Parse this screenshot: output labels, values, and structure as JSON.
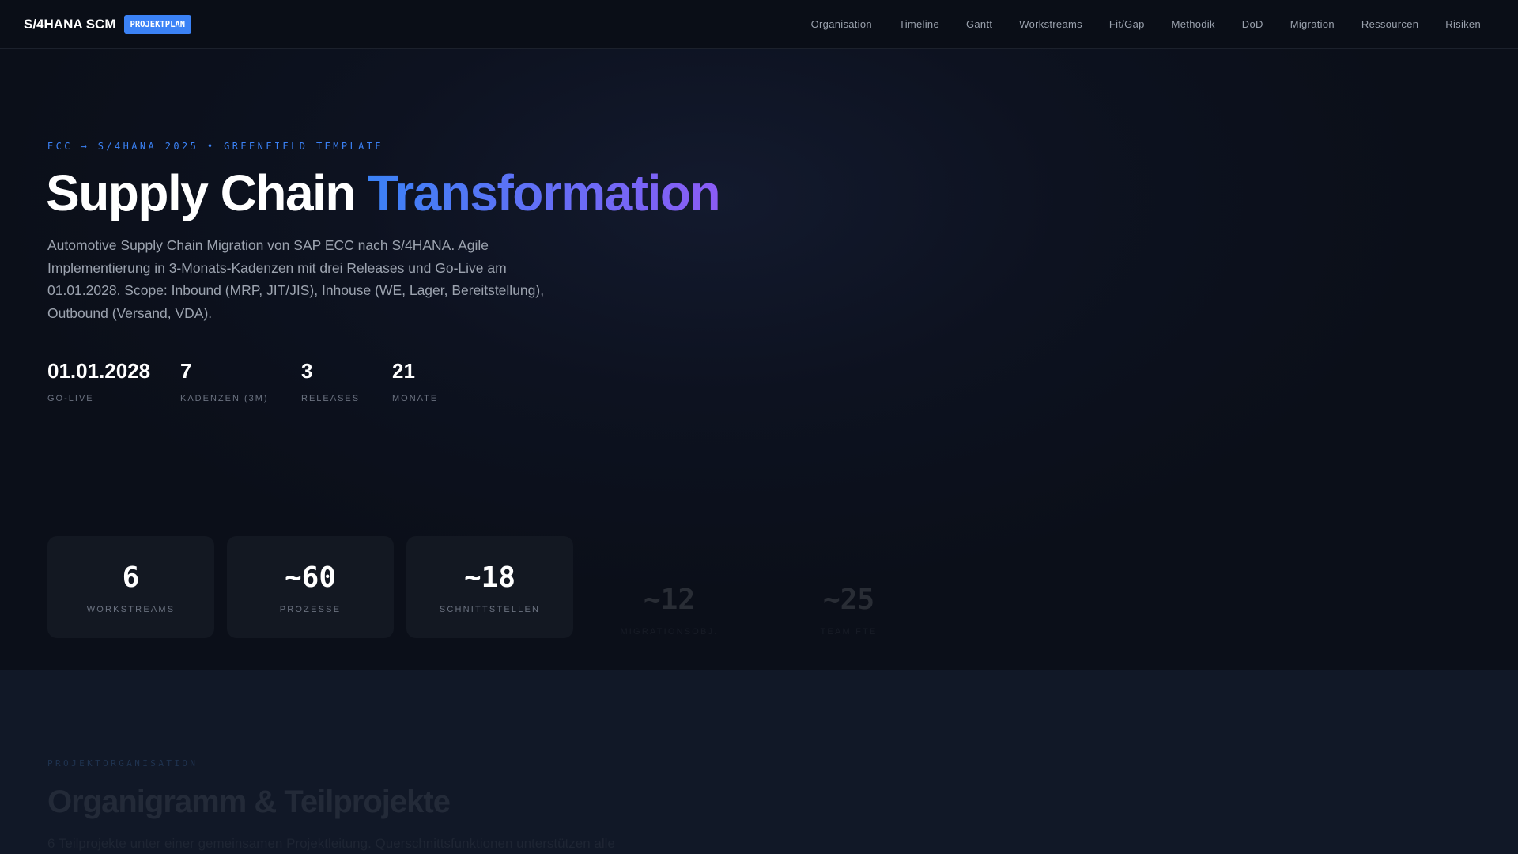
{
  "nav": {
    "logo": "S/4HANA SCM",
    "badge": "PROJEKTPLAN",
    "links": [
      "Organisation",
      "Timeline",
      "Gantt",
      "Workstreams",
      "Fit/Gap",
      "Methodik",
      "DoD",
      "Migration",
      "Ressourcen",
      "Risiken"
    ]
  },
  "hero": {
    "eyebrow": "ECC → S/4HANA 2025 • GREENFIELD TEMPLATE",
    "title_a": "Supply Chain ",
    "title_b": "Transformation",
    "lead": "Automotive Supply Chain Migration von SAP ECC nach S/4HANA. Agile Implementierung in 3-Monats-Kadenzen mit drei Releases und Go-Live am 01.01.2028. Scope: Inbound (MRP, JIT/JIS), Inhouse (WE, Lager, Bereitstellung), Outbound (Versand, VDA).",
    "stats": [
      {
        "value": "01.01.2028",
        "label": "GO-LIVE"
      },
      {
        "value": "7",
        "label": "KADENZEN (3M)"
      },
      {
        "value": "3",
        "label": "RELEASES"
      },
      {
        "value": "21",
        "label": "MONATE"
      }
    ],
    "cards": [
      {
        "value": "6",
        "label": "WORKSTREAMS"
      },
      {
        "value": "~60",
        "label": "PROZESSE"
      },
      {
        "value": "~18",
        "label": "SCHNITTSTELLEN"
      },
      {
        "value": "~12",
        "label": "MIGRATIONSOBJ."
      },
      {
        "value": "~25",
        "label": "TEAM FTE"
      }
    ]
  },
  "section": {
    "eyebrow": "PROJEKTORGANISATION",
    "title": "Organigramm & Teilprojekte",
    "text": "6 Teilprojekte unter einer gemeinsamen Projektleitung. Querschnittsfunktionen unterstützen alle"
  }
}
